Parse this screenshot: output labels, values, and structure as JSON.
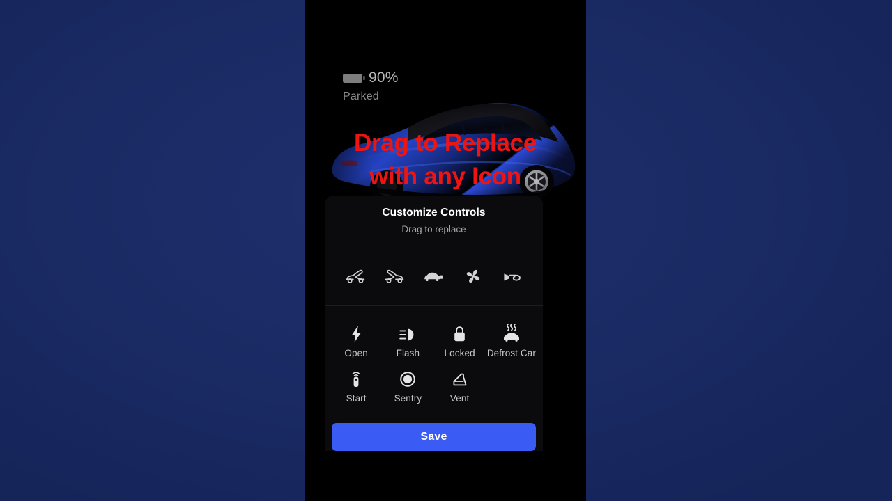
{
  "colors": {
    "backdrop": "#1a2a63",
    "phone_bg": "#000000",
    "sheet_bg": "#0b0b0d",
    "accent_save": "#3b5bf5",
    "overlay_red": "#ee1411",
    "car_blue": "#1f3fb0"
  },
  "vehicle_status": {
    "battery_percent": "90%",
    "battery_icon": "battery-icon",
    "state": "Parked",
    "car_image_alt": "blue-tesla-car"
  },
  "overlay": {
    "line1": "Drag to Replace",
    "line2": "with any Icon"
  },
  "sheet": {
    "title": "Customize Controls",
    "subtitle": "Drag to replace",
    "palette": [
      {
        "name": "frunk-open-icon",
        "label": "Frunk"
      },
      {
        "name": "trunk-open-icon",
        "label": "Trunk"
      },
      {
        "name": "car-charging-icon",
        "label": "Charge"
      },
      {
        "name": "fan-climate-icon",
        "label": "Climate"
      },
      {
        "name": "horn-icon",
        "label": "Horn"
      }
    ],
    "controls": [
      {
        "label": "Open",
        "icon": "lightning-bolt-icon"
      },
      {
        "label": "Flash",
        "icon": "headlight-flash-icon"
      },
      {
        "label": "Locked",
        "icon": "padlock-closed-icon"
      },
      {
        "label": "Defrost Car",
        "icon": "defrost-car-icon"
      },
      {
        "label": "Start",
        "icon": "key-fob-icon"
      },
      {
        "label": "Sentry",
        "icon": "sentry-camera-icon"
      },
      {
        "label": "Vent",
        "icon": "window-vent-icon"
      }
    ],
    "save_label": "Save"
  }
}
